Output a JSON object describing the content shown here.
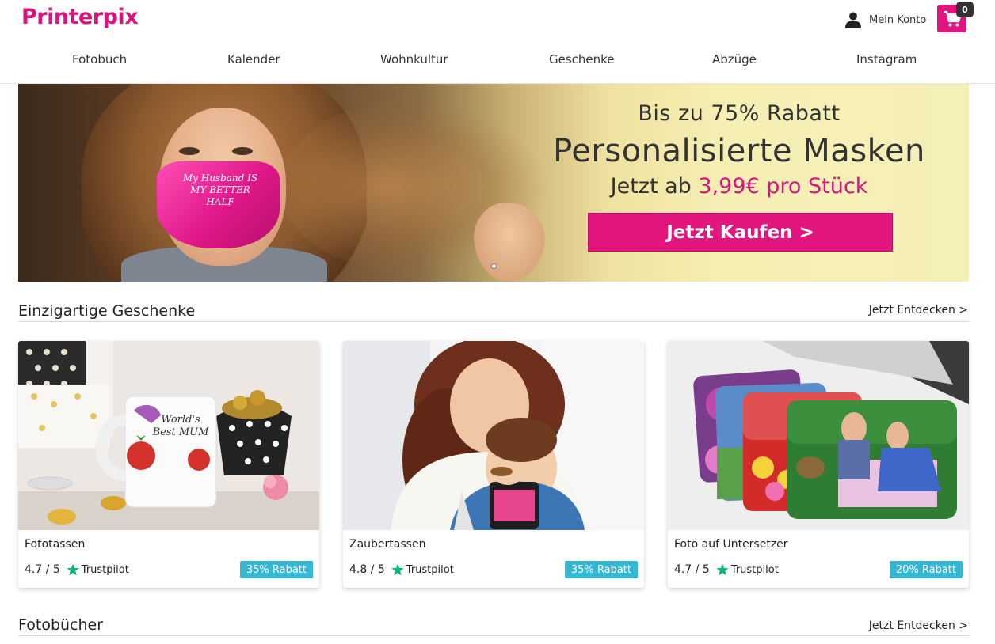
{
  "brand": {
    "logo_text": "Printerpix",
    "color": "#d6157f"
  },
  "header": {
    "account_label": "Mein Konto",
    "cart_count": "0"
  },
  "nav": [
    "Fotobuch",
    "Kalender",
    "Wohnkultur",
    "Geschenke",
    "Abzüge",
    "Instagram"
  ],
  "hero": {
    "subtitle": "Bis zu 75% Rabatt",
    "title": "Personalisierte Masken",
    "price_prefix": "Jetzt ab ",
    "price_highlight": "3,99€ pro Stück",
    "cta_label": "Jetzt Kaufen >",
    "mask_text": "My Husband IS MY BETTER HALF",
    "cta_color": "#e3157f"
  },
  "sections": [
    {
      "title": "Einzigartige Geschenke",
      "link_label": "Jetzt Entdecken >"
    },
    {
      "title": "Fotobücher",
      "link_label": "Jetzt Entdecken >"
    }
  ],
  "products": [
    {
      "name": "Fototassen",
      "rating": "4.7 / 5",
      "reviews_source": "Trustpilot",
      "badge": "35% Rabatt",
      "mug_text": "World's Best MUM",
      "image_icon": "mug-image"
    },
    {
      "name": "Zaubertassen",
      "rating": "4.8 / 5",
      "reviews_source": "Trustpilot",
      "badge": "35% Rabatt",
      "image_icon": "mother-child-image"
    },
    {
      "name": "Foto auf Untersetzer",
      "rating": "4.7 / 5",
      "reviews_source": "Trustpilot",
      "badge": "20% Rabatt",
      "image_icon": "coasters-image"
    }
  ],
  "colors": {
    "badge": "#35b6d3",
    "trustpilot_star": "#00b67a"
  }
}
